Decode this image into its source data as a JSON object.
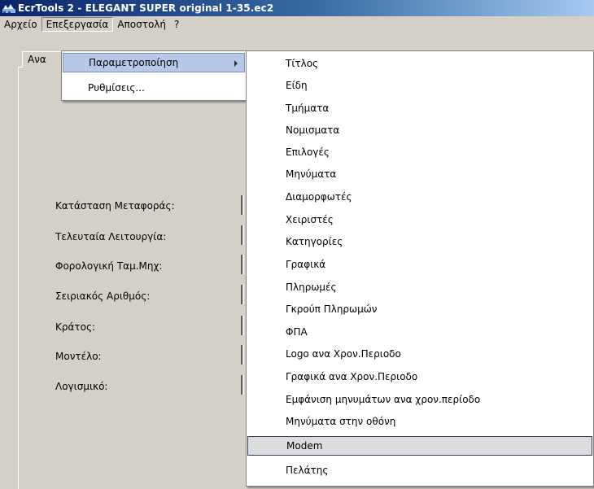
{
  "window": {
    "title": "EcrTools 2 - ELEGANT SUPER original 1-35.ec2"
  },
  "menubar": {
    "items": [
      "Αρχείο",
      "Επεξεργασία",
      "Αποστολή",
      "?"
    ],
    "active": "Επεξεργασία"
  },
  "tab": {
    "label": "Ανα"
  },
  "info_labels": [
    "Κατάσταση Μεταφοράς:",
    "Τελευταία Λειτουργία:",
    "Φορολογική Ταμ.Μηχ:",
    "Σειριακός Αριθμός:",
    "Κράτος:",
    "Μοντέλο:",
    "Λογισμικό:"
  ],
  "edit_menu": {
    "items": [
      "Παραμετροποίηση",
      "Ρυθμίσεις..."
    ],
    "highlighted": "Παραμετροποίηση"
  },
  "submenu": {
    "items": [
      "Τίτλος",
      "Είδη",
      "Τμήματα",
      "Νομισματα",
      "Επιλογές",
      "Μηνύματα",
      "Διαμορφωτές",
      "Χειριστές",
      "Κατηγορίες",
      "Γραφικά",
      "Πληρωμές",
      "Γκρούπ Πληρωμών",
      "ΦΠΑ",
      "Logo ανα Χρον.Περιοδο",
      "Γραφικά ανα Χρον.Περιοδο",
      "Εμφάνιση μηνυμάτων ανα χρον.περίοδο",
      "Μηνύματα στην οθόνη",
      "Modem",
      "Πελάτης"
    ],
    "highlighted": "Modem"
  }
}
